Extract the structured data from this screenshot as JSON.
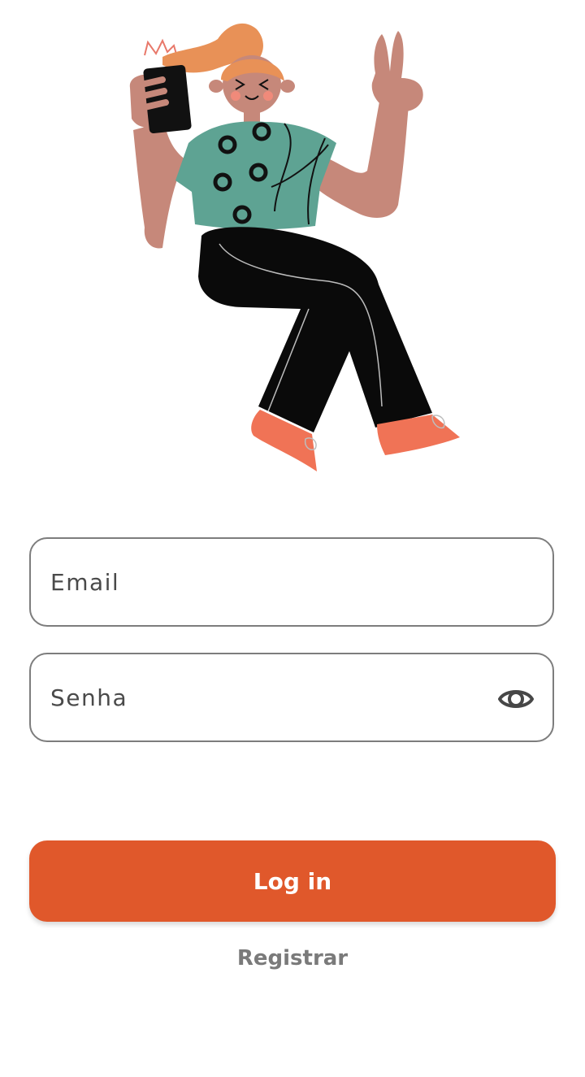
{
  "login_form": {
    "email": {
      "placeholder": "Email",
      "value": ""
    },
    "password": {
      "placeholder": "Senha",
      "value": "",
      "toggle_icon": "eye-icon"
    },
    "login_label": "Log in",
    "register_label": "Registrar"
  },
  "colors": {
    "primary": "#e0582b",
    "field_border": "#7d7d7d",
    "secondary_text": "#7a7a7a"
  }
}
